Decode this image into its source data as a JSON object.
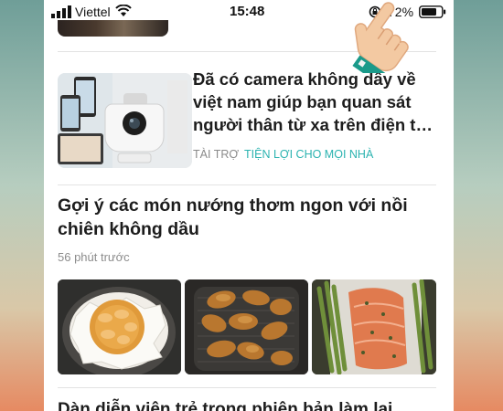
{
  "status_bar": {
    "carrier": "Viettel",
    "time": "15:48",
    "battery_percent": "72%",
    "icons": [
      "signal-icon",
      "wifi-icon",
      "orientation-lock-icon",
      "battery-icon"
    ]
  },
  "feed": {
    "ad": {
      "title": "Đã có camera  không dây về việt nam giúp bạn quan sát người thân từ xa trên điện t…",
      "sponsor_label": "TÀI TRỢ",
      "source": "TIỆN LỢI CHO MỌI NHÀ"
    },
    "article": {
      "title": "Gợi ý các món nướng thơm ngon với nồi chiên không dầu",
      "time": "56 phút trước",
      "images": [
        "baked-pie-image",
        "chicken-wings-image",
        "salmon-asparagus-image"
      ]
    },
    "next_article": {
      "title": "Dàn diễn viên trẻ trong phiên bản làm lại"
    }
  },
  "colors": {
    "accent_teal": "#2bb3b0",
    "hand_cuff": "#1a9a8a",
    "text_dark": "#1d1d1d",
    "text_muted": "#8a8a8a"
  }
}
